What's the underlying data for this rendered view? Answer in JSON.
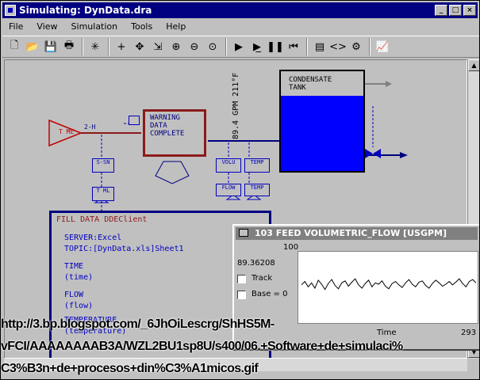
{
  "window": {
    "title": "Simulating: DynData.dra",
    "buttons": [
      "_",
      "□",
      "×"
    ]
  },
  "menu": [
    "File",
    "View",
    "Simulation",
    "Tools",
    "Help"
  ],
  "toolbar": {
    "icons": [
      "new-icon",
      "open-icon",
      "save-icon",
      "print-icon",
      "sep",
      "burst-icon",
      "sep",
      "crosshair-icon",
      "move-icon",
      "connect-icon",
      "zoom-in-icon",
      "zoom-out-icon",
      "zoom-fit-icon",
      "sep",
      "run-icon",
      "step-icon",
      "pause-icon",
      "reset-icon",
      "sep",
      "chart-window-icon",
      "code-icon",
      "settings-icon",
      "sep",
      "trend-icon"
    ],
    "glyphs": [
      "🗋",
      "📂",
      "💾",
      "🖶",
      "|",
      "✳",
      "|",
      "+",
      "✥",
      "⇲",
      "⊕",
      "⊖",
      "⊙",
      "|",
      "▶",
      "▶̲",
      "❚❚",
      "⏮",
      "|",
      "▤",
      "<>",
      "⚙",
      "|",
      "📈"
    ]
  },
  "diagram": {
    "transmitter_label": "T ME",
    "flow_marker": "2-H",
    "alarm_box": "WARNING\nDATA\nCOMPLETE",
    "tags": {
      "left_top": "S-SN",
      "left_bottom": "T ML",
      "mid_top1": "VOLU",
      "mid_top2": "TEMP",
      "mid_bot1": "FLOW",
      "mid_bot2": "TEMP"
    },
    "vertical_readout": "89.4 GPM 211°F",
    "tank_label": "CONDENSATE\nTANK",
    "dde": {
      "header": "FILL DATA DDEClient",
      "server": "SERVER:Excel",
      "topic": "TOPIC:[DynData.xls]Sheet1",
      "time_label": "TIME",
      "time_value": "(time)",
      "flow_label": "FLOW",
      "flow_value": "(flow)",
      "temp_label": "TEMPERATURE",
      "temp_value": "(temperature)"
    }
  },
  "trend": {
    "title": "103 FEED VOLUMETRIC_FLOW [USGPM]",
    "ymax": "100",
    "current_value": "89.36208",
    "track_label": "Track",
    "base_label": "Base = 0",
    "x_label": "Time",
    "x_value": "293"
  },
  "chart_data": {
    "type": "line",
    "title": "103 FEED VOLUMETRIC_FLOW [USGPM]",
    "xlabel": "Time",
    "ylabel": "",
    "ylim": [
      0,
      100
    ],
    "x_end": 293,
    "series": [
      {
        "values": [
          55,
          60,
          52,
          58,
          50,
          62,
          56,
          48,
          57,
          63,
          54,
          49,
          58,
          61,
          53,
          59,
          64,
          55,
          50,
          57,
          62,
          52,
          58,
          56,
          61,
          53,
          49,
          57,
          60,
          55,
          51,
          58,
          63,
          56,
          52,
          59,
          61,
          54,
          50,
          57,
          62,
          58,
          53,
          56,
          60,
          55,
          59,
          64,
          57,
          52,
          60,
          63,
          58
        ]
      }
    ]
  },
  "overlay_url": [
    "http://3.bp.blogspot.com/_6JhOiLescrg/ShHS5M-",
    "vFCI/AAAAAAAAB3A/WZL2BU1sp8U/s400/06.+Software+de+simulaci%",
    "C3%B3n+de+procesos+din%C3%A1micos.gif"
  ]
}
